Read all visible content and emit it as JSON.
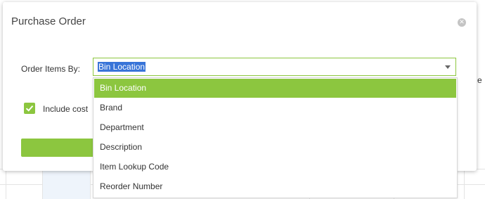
{
  "dialog": {
    "title": "Purchase Order",
    "close_icon": "close-circle-icon"
  },
  "order_items_by": {
    "label": "Order Items By:",
    "selected_value": "Bin Location",
    "options": [
      "Bin Location",
      "Brand",
      "Department",
      "Description",
      "Item Lookup Code",
      "Reorder Number"
    ]
  },
  "include_cost": {
    "label": "Include cost",
    "checked": true
  },
  "background": {
    "peek_text": "e"
  },
  "colors": {
    "accent": "#8cc63f",
    "selection": "#3874d8"
  }
}
